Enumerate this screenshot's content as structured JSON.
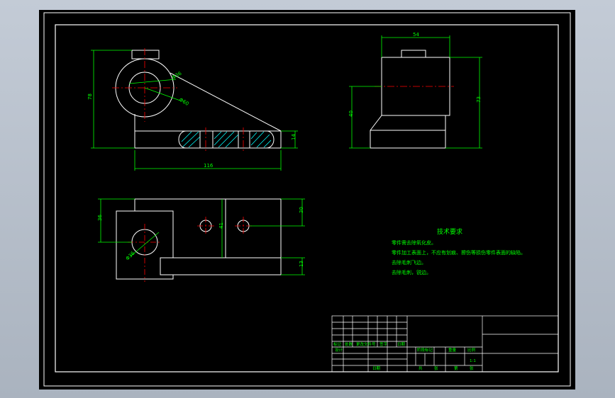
{
  "colors": {
    "background": "#000000",
    "geometry": "#ffffff",
    "dimension": "#00ff00",
    "centerline": "#ff0000",
    "hatch": "#00ffff",
    "frame_outer": "#c3cbd6"
  },
  "front_view": {
    "dim_height": "78",
    "dim_width": "116",
    "dim_right": "14",
    "dim_hole": "Φ36",
    "dim_bore": "Φ60"
  },
  "side_view": {
    "dim_top": "54",
    "dim_height_right": "73",
    "dim_height_left": "40"
  },
  "top_view": {
    "dim_left": "36",
    "dim_mid": "41",
    "dim_right_top": "30",
    "dim_right_bottom": "13",
    "dim_hole": "Φ36"
  },
  "tech_notes": {
    "title": "技术要求",
    "lines": [
      "零件需去除氧化皮。",
      "零件加工表面上，不应有划痕、擦伤等损伤零件表面的缺陷。",
      "去除毛刺飞边。",
      "去除毛刺，锐边。"
    ]
  },
  "title_block": {
    "rev_mark": "标记",
    "rev_count": "处数",
    "rev_file": "更改文件号",
    "rev_sign": "签字",
    "rev_date": "日期",
    "designer": "设计",
    "stage_mark": "阶段标记",
    "weight": "重量",
    "scale": "比例",
    "scale_value": "1:1",
    "sheet_total": "共",
    "sheet_label": "张",
    "sheet_no": "第",
    "date": "日期"
  }
}
